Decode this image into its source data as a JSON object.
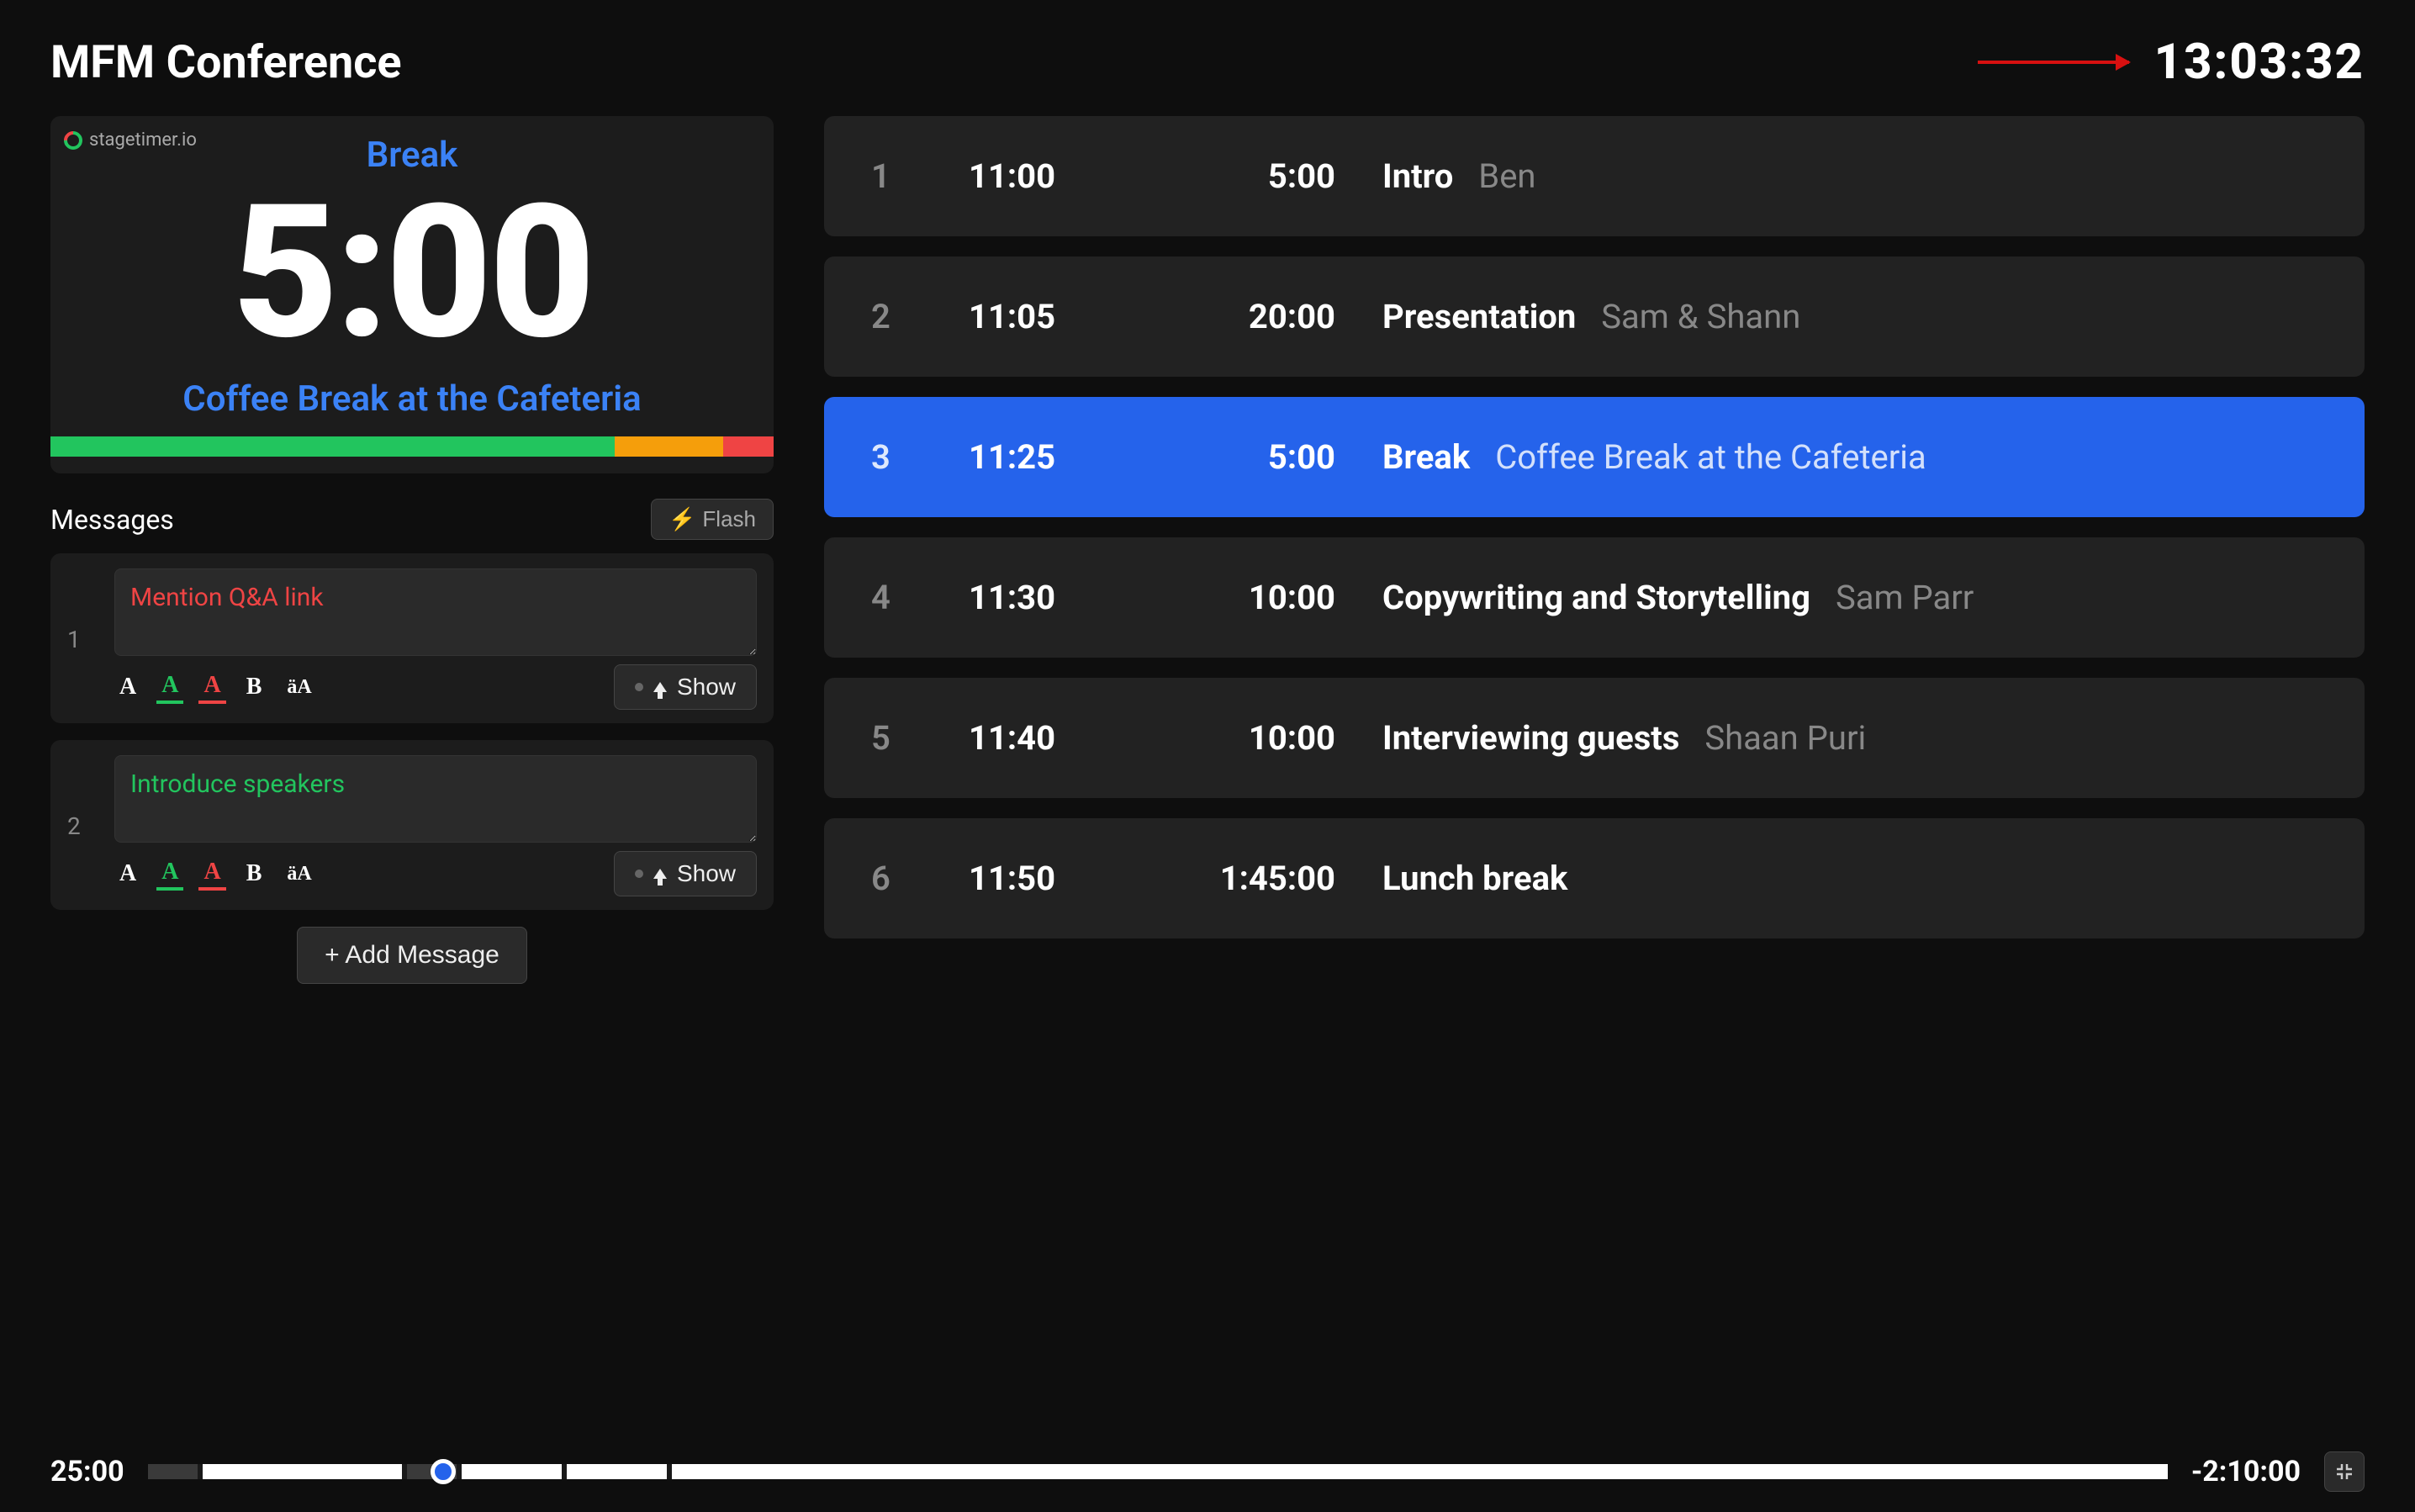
{
  "header": {
    "title": "MFM Conference",
    "clock": "13:03:32"
  },
  "timer_card": {
    "brand": "stagetimer.io",
    "label": "Break",
    "time": "5:00",
    "subtitle": "Coffee Break at the Cafeteria",
    "progress": {
      "green_pct": 78,
      "orange_pct": 15,
      "red_pct": 7
    }
  },
  "messages": {
    "title": "Messages",
    "flash_label": "Flash",
    "show_label": "Show",
    "add_label": "+ Add Message",
    "items": [
      {
        "num": "1",
        "text": "Mention Q&A link",
        "color": "red"
      },
      {
        "num": "2",
        "text": "Introduce speakers",
        "color": "green"
      }
    ]
  },
  "schedule": [
    {
      "num": "1",
      "start": "11:00",
      "duration": "5:00",
      "title": "Intro",
      "speaker": "Ben",
      "active": false
    },
    {
      "num": "2",
      "start": "11:05",
      "duration": "20:00",
      "title": "Presentation",
      "speaker": "Sam & Shann",
      "active": false
    },
    {
      "num": "3",
      "start": "11:25",
      "duration": "5:00",
      "title": "Break",
      "speaker": "Coffee Break at the Cafeteria",
      "active": true
    },
    {
      "num": "4",
      "start": "11:30",
      "duration": "10:00",
      "title": "Copywriting and Storytelling",
      "speaker": "Sam Parr",
      "active": false
    },
    {
      "num": "5",
      "start": "11:40",
      "duration": "10:00",
      "title": "Interviewing guests",
      "speaker": "Shaan Puri",
      "active": false
    },
    {
      "num": "6",
      "start": "11:50",
      "duration": "1:45:00",
      "title": "Lunch break",
      "speaker": "",
      "active": false
    }
  ],
  "bottom_bar": {
    "elapsed": "25:00",
    "remaining": "-2:10:00",
    "playhead_pct": 14,
    "segments": [
      {
        "w": 2.5,
        "filled": false
      },
      {
        "w": 10,
        "filled": true
      },
      {
        "w": 2.5,
        "filled": false
      },
      {
        "w": 5,
        "filled": true
      },
      {
        "w": 5,
        "filled": true
      },
      {
        "w": 75,
        "filled": true
      }
    ]
  }
}
